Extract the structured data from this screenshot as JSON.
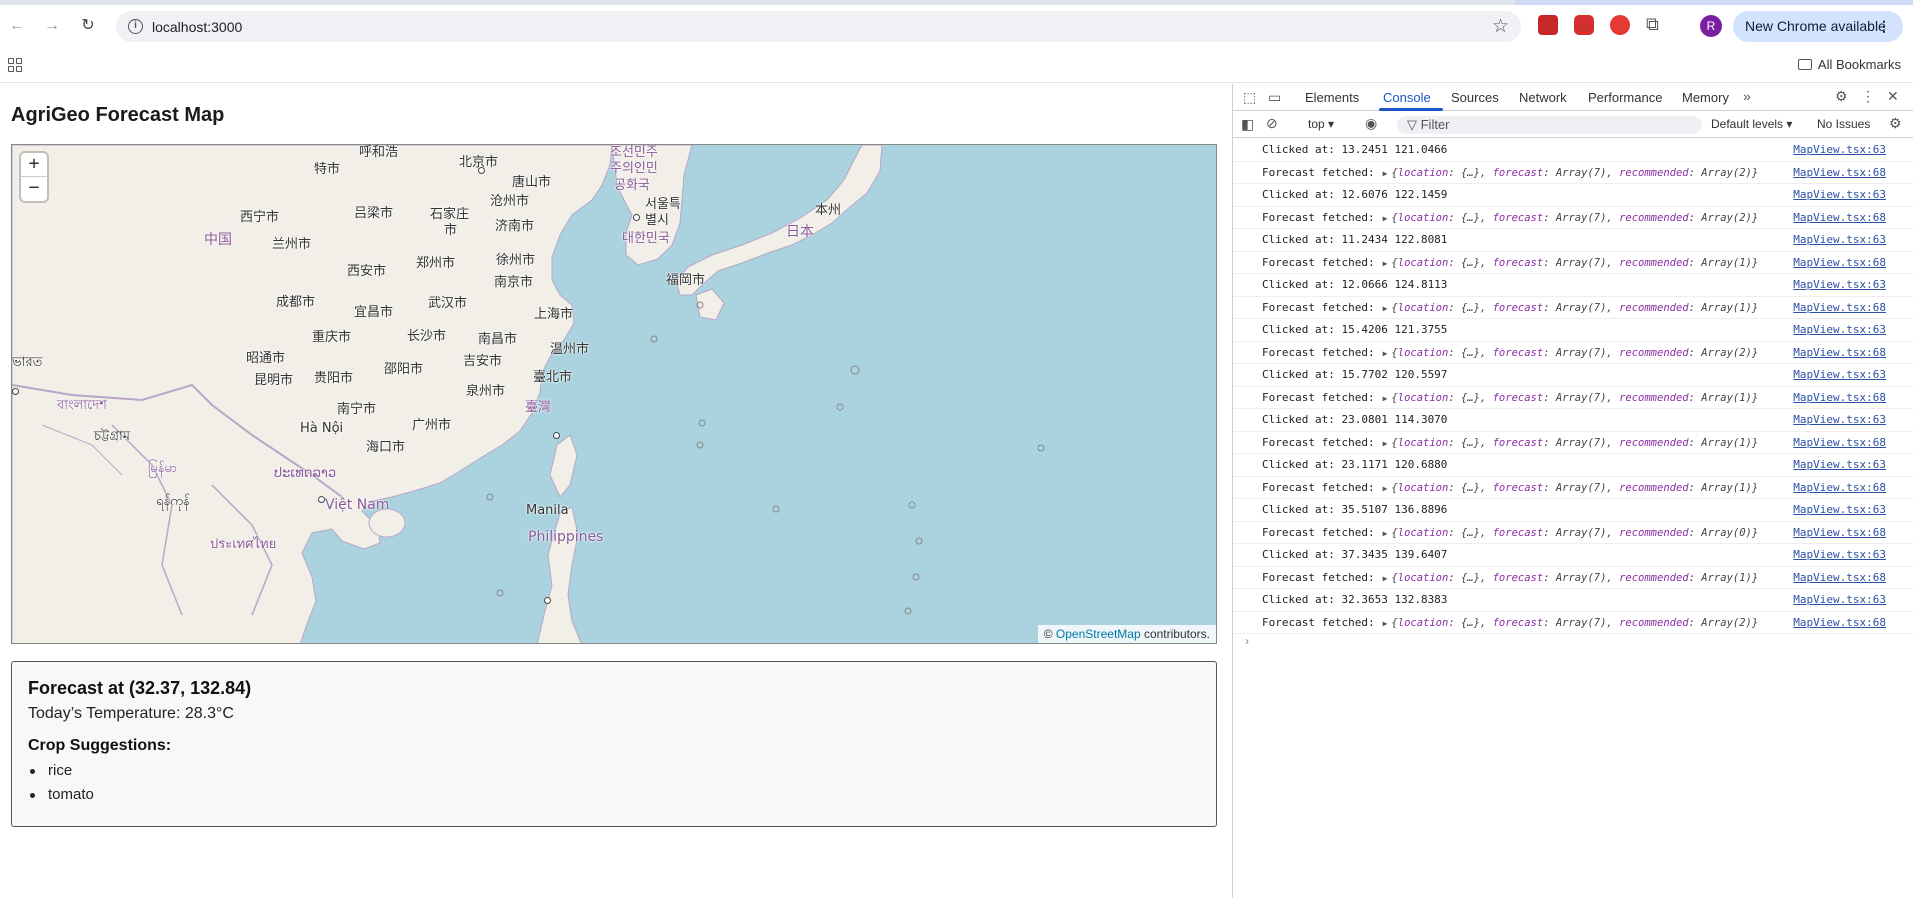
{
  "browser": {
    "url": "localhost:3000",
    "new_chrome": "New Chrome available",
    "avatar_letter": "R",
    "all_bookmarks": "All Bookmarks"
  },
  "page": {
    "title": "AgriGeo Forecast Map",
    "map": {
      "zoom_in": "+",
      "zoom_out": "−",
      "attribution_prefix": "© ",
      "attribution_link": "OpenStreetMap",
      "attribution_suffix": " contributors.",
      "labels": [
        {
          "text": "呼和浩",
          "cls": ""
        },
        {
          "text": "特市",
          "cls": ""
        },
        {
          "text": "北京市",
          "cls": ""
        },
        {
          "text": "唐山市",
          "cls": ""
        },
        {
          "text": "조선민주",
          "cls": "country"
        },
        {
          "text": "주의인민",
          "cls": "country"
        },
        {
          "text": "공화국",
          "cls": "country"
        },
        {
          "text": "西宁市",
          "cls": ""
        },
        {
          "text": "吕梁市",
          "cls": ""
        },
        {
          "text": "石家庄",
          "cls": ""
        },
        {
          "text": "市",
          "cls": ""
        },
        {
          "text": "沧州市",
          "cls": ""
        },
        {
          "text": "서울특",
          "cls": ""
        },
        {
          "text": "별시",
          "cls": ""
        },
        {
          "text": "济南市",
          "cls": ""
        },
        {
          "text": "대한민국",
          "cls": "country"
        },
        {
          "text": "本州",
          "cls": ""
        },
        {
          "text": "中国",
          "cls": "country big"
        },
        {
          "text": "兰州市",
          "cls": ""
        },
        {
          "text": "日本",
          "cls": "country big"
        },
        {
          "text": "郑州市",
          "cls": ""
        },
        {
          "text": "徐州市",
          "cls": ""
        },
        {
          "text": "西安市",
          "cls": ""
        },
        {
          "text": "福岡市",
          "cls": ""
        },
        {
          "text": "南京市",
          "cls": ""
        },
        {
          "text": "成都市",
          "cls": ""
        },
        {
          "text": "武汉市",
          "cls": ""
        },
        {
          "text": "宜昌市",
          "cls": ""
        },
        {
          "text": "上海市",
          "cls": ""
        },
        {
          "text": "重庆市",
          "cls": ""
        },
        {
          "text": "长沙市",
          "cls": ""
        },
        {
          "text": "南昌市",
          "cls": ""
        },
        {
          "text": "温州市",
          "cls": ""
        },
        {
          "text": "昭通市",
          "cls": ""
        },
        {
          "text": "邵阳市",
          "cls": ""
        },
        {
          "text": "吉安市",
          "cls": ""
        },
        {
          "text": "ভারত",
          "cls": ""
        },
        {
          "text": "昆明市",
          "cls": ""
        },
        {
          "text": "贵阳市",
          "cls": ""
        },
        {
          "text": "臺北市",
          "cls": ""
        },
        {
          "text": "泉州市",
          "cls": ""
        },
        {
          "text": "臺灣",
          "cls": "country"
        },
        {
          "text": "南宁市",
          "cls": ""
        },
        {
          "text": "বাংলাদেশ",
          "cls": "country"
        },
        {
          "text": "广州市",
          "cls": ""
        },
        {
          "text": "Hà Nội",
          "cls": ""
        },
        {
          "text": "চট্টগ্রাম",
          "cls": ""
        },
        {
          "text": "海口市",
          "cls": ""
        },
        {
          "text": "မြန်မာ",
          "cls": "country"
        },
        {
          "text": "ປະເທດລາວ",
          "cls": "country"
        },
        {
          "text": "Việt Nam",
          "cls": "country big"
        },
        {
          "text": "ရန်ကုန်",
          "cls": ""
        },
        {
          "text": "Manila",
          "cls": ""
        },
        {
          "text": "Philippines",
          "cls": "country big"
        },
        {
          "text": "ประเทศไทย",
          "cls": "country"
        }
      ]
    },
    "forecast": {
      "title": "Forecast at (32.37, 132.84)",
      "temperature": "Today’s Temperature: 28.3°C",
      "crops_heading": "Crop Suggestions:",
      "crops": [
        "rice",
        "tomato"
      ]
    }
  },
  "devtools": {
    "tabs": [
      "Elements",
      "Console",
      "Sources",
      "Network",
      "Performance",
      "Memory"
    ],
    "active_tab": "Console",
    "context": "top",
    "filter_placeholder": "Filter",
    "levels": "Default levels",
    "issues": "No Issues",
    "console_rows": [
      {
        "type": "click",
        "text": "Clicked at: 13.2451 121.0466",
        "src": "MapView.tsx:63"
      },
      {
        "type": "fetch",
        "rec": "Array(2)",
        "src": "MapView.tsx:68"
      },
      {
        "type": "click",
        "text": "Clicked at: 12.6076 122.1459",
        "src": "MapView.tsx:63"
      },
      {
        "type": "fetch",
        "rec": "Array(2)",
        "src": "MapView.tsx:68"
      },
      {
        "type": "click",
        "text": "Clicked at: 11.2434 122.8081",
        "src": "MapView.tsx:63"
      },
      {
        "type": "fetch",
        "rec": "Array(1)",
        "src": "MapView.tsx:68"
      },
      {
        "type": "click",
        "text": "Clicked at: 12.0666 124.8113",
        "src": "MapView.tsx:63"
      },
      {
        "type": "fetch",
        "rec": "Array(1)",
        "src": "MapView.tsx:68"
      },
      {
        "type": "click",
        "text": "Clicked at: 15.4206 121.3755",
        "src": "MapView.tsx:63"
      },
      {
        "type": "fetch",
        "rec": "Array(2)",
        "src": "MapView.tsx:68"
      },
      {
        "type": "click",
        "text": "Clicked at: 15.7702 120.5597",
        "src": "MapView.tsx:63"
      },
      {
        "type": "fetch",
        "rec": "Array(1)",
        "src": "MapView.tsx:68"
      },
      {
        "type": "click",
        "text": "Clicked at: 23.0801 114.3070",
        "src": "MapView.tsx:63"
      },
      {
        "type": "fetch",
        "rec": "Array(1)",
        "src": "MapView.tsx:68"
      },
      {
        "type": "click",
        "text": "Clicked at: 23.1171 120.6880",
        "src": "MapView.tsx:63"
      },
      {
        "type": "fetch",
        "rec": "Array(1)",
        "src": "MapView.tsx:68"
      },
      {
        "type": "click",
        "text": "Clicked at: 35.5107 136.8896",
        "src": "MapView.tsx:63"
      },
      {
        "type": "fetch",
        "rec": "Array(0)",
        "src": "MapView.tsx:68"
      },
      {
        "type": "click",
        "text": "Clicked at: 37.3435 139.6407",
        "src": "MapView.tsx:63"
      },
      {
        "type": "fetch",
        "rec": "Array(1)",
        "src": "MapView.tsx:68"
      },
      {
        "type": "click",
        "text": "Clicked at: 32.3653 132.8383",
        "src": "MapView.tsx:63"
      },
      {
        "type": "fetch",
        "rec": "Array(2)",
        "src": "MapView.tsx:68"
      }
    ],
    "fetch_label": "Forecast fetched:",
    "fetch_location": "location",
    "fetch_forecast": "forecast",
    "fetch_recommended": "recommended",
    "fetch_obj_text": "{…}",
    "fetch_forecast_val": "Array(7)"
  }
}
